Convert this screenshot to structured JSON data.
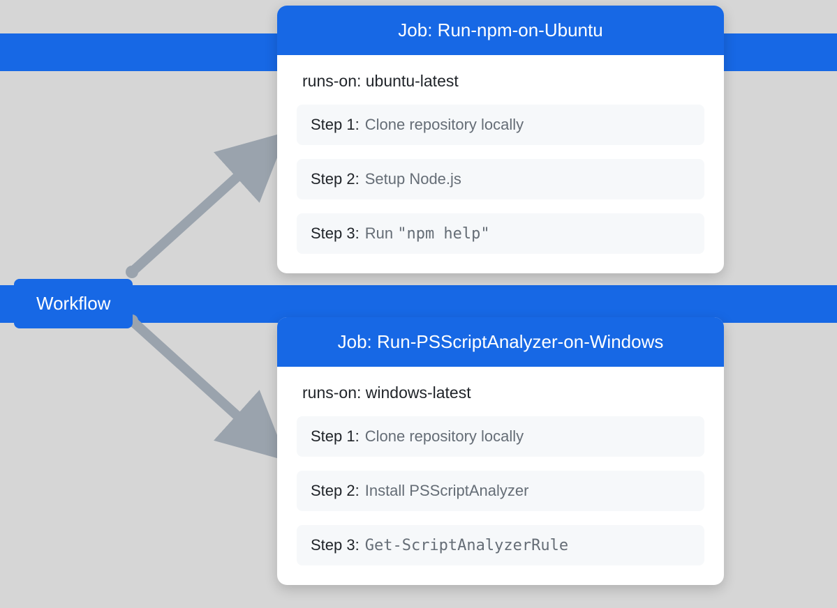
{
  "workflow": {
    "label": "Workflow"
  },
  "jobs": [
    {
      "title": "Job: Run-npm-on-Ubuntu",
      "runsOn": "runs-on: ubuntu-latest",
      "steps": [
        {
          "label": "Step 1:",
          "desc": "Clone repository locally",
          "code": false
        },
        {
          "label": "Step 2:",
          "desc": "Setup Node.js",
          "code": false
        },
        {
          "label": "Step 3:",
          "descPrefix": "Run ",
          "descCode": "\"npm help\"",
          "code": true
        }
      ]
    },
    {
      "title": "Job: Run-PSScriptAnalyzer-on-Windows",
      "runsOn": "runs-on: windows-latest",
      "steps": [
        {
          "label": "Step 1:",
          "desc": "Clone repository locally",
          "code": false
        },
        {
          "label": "Step 2:",
          "desc": "Install PSScriptAnalyzer",
          "code": false
        },
        {
          "label": "Step 3:",
          "descPrefix": "",
          "descCode": "Get-ScriptAnalyzerRule",
          "code": true
        }
      ]
    }
  ]
}
